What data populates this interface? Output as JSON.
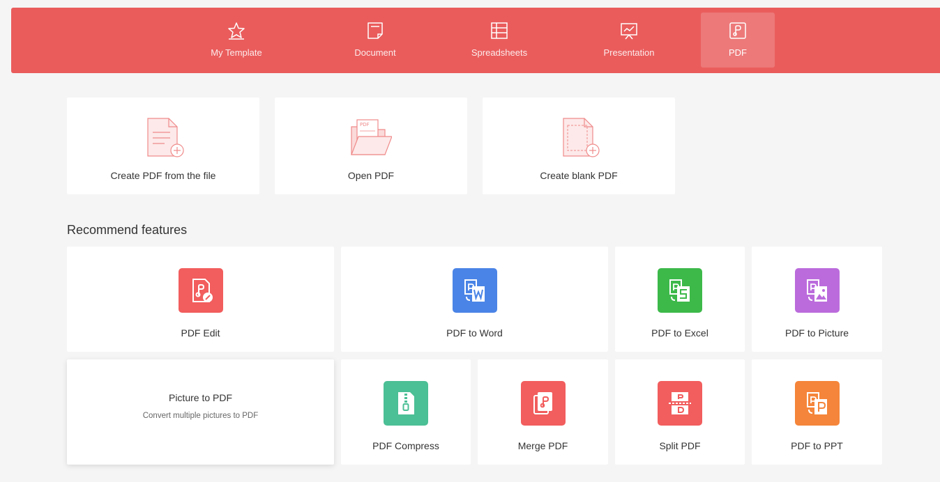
{
  "nav": {
    "items": [
      {
        "label": "My Template",
        "icon": "star-icon"
      },
      {
        "label": "Document",
        "icon": "document-icon"
      },
      {
        "label": "Spreadsheets",
        "icon": "spreadsheet-icon"
      },
      {
        "label": "Presentation",
        "icon": "presentation-icon"
      },
      {
        "label": "PDF",
        "icon": "pdf-icon",
        "active": true
      }
    ],
    "accent": "#ea5c5c"
  },
  "create": {
    "items": [
      {
        "label": "Create PDF from the file",
        "icon": "create-pdf-from-file-icon"
      },
      {
        "label": "Open PDF",
        "icon": "open-pdf-folder-icon"
      },
      {
        "label": "Create blank PDF",
        "icon": "create-blank-pdf-icon"
      }
    ],
    "open_pdf_badge": "PDF"
  },
  "features": {
    "title": "Recommend features",
    "row1": [
      {
        "label": "PDF Edit",
        "icon": "pdf-edit-icon",
        "color": "#f25d5d"
      },
      {
        "label": "PDF to Word",
        "icon": "pdf-to-word-icon",
        "color": "#4a84e6"
      },
      {
        "label": "PDF to Excel",
        "icon": "pdf-to-excel-icon",
        "color": "#3db94a"
      },
      {
        "label": "PDF to Picture",
        "icon": "pdf-to-picture-icon",
        "color": "#bb6bdc"
      }
    ],
    "picture_to_pdf": {
      "title": "Picture to PDF",
      "description": "Convert multiple pictures to PDF"
    },
    "row2": [
      {
        "label": "PDF Compress",
        "icon": "pdf-compress-icon",
        "color": "#4bbf95"
      },
      {
        "label": "Merge PDF",
        "icon": "merge-pdf-icon",
        "color": "#f25d5d"
      },
      {
        "label": "Split PDF",
        "icon": "split-pdf-icon",
        "color": "#f25d5d"
      },
      {
        "label": "PDF to PPT",
        "icon": "pdf-to-ppt-icon",
        "color": "#f5853a"
      }
    ]
  }
}
